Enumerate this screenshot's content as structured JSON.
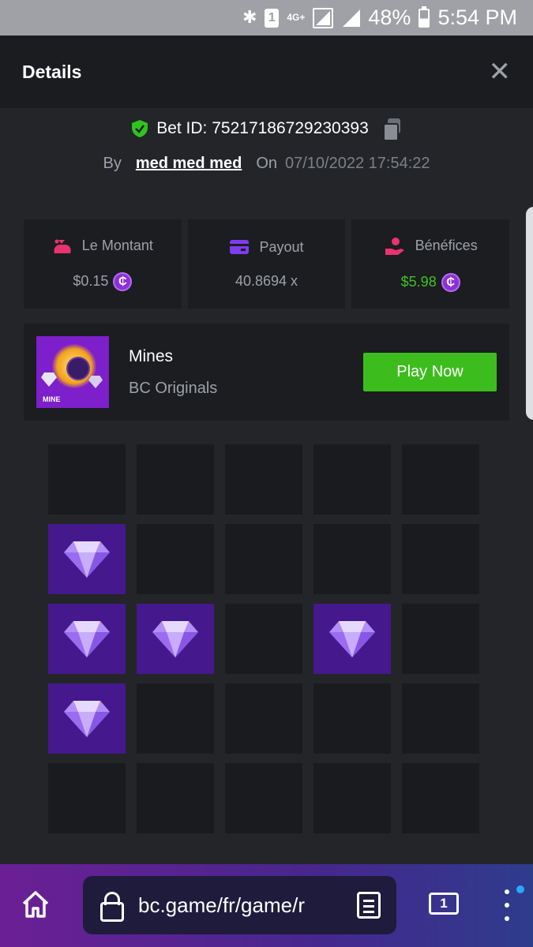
{
  "status_bar": {
    "network": "4G+",
    "sim": "1",
    "battery": "48%",
    "time": "5:54 PM"
  },
  "header": {
    "title": "Details"
  },
  "bet": {
    "id_label": "Bet ID: 75217186729230393",
    "by_label": "By",
    "user": "med med med",
    "on_label": "On",
    "date": "07/10/2022 17:54:22"
  },
  "stats": [
    {
      "label": "Le Montant",
      "value": "$0.15",
      "icon": "money-bag-icon",
      "color": "#e8336f"
    },
    {
      "label": "Payout",
      "value": "40.8694 x",
      "icon": "card-icon",
      "color": "#7d3cf0"
    },
    {
      "label": "Bénéfices",
      "value": "$5.98",
      "icon": "hand-coin-icon",
      "color": "#e8336f"
    }
  ],
  "coin_symbol": "₵",
  "game": {
    "name": "Mines",
    "provider": "BC Originals",
    "thumb_label": "MINE",
    "play_label": "Play Now"
  },
  "grid": {
    "rows": 5,
    "cols": 5,
    "tiles": [
      0,
      0,
      0,
      0,
      0,
      1,
      0,
      0,
      0,
      0,
      1,
      1,
      0,
      1,
      0,
      1,
      0,
      0,
      0,
      0,
      0,
      0,
      0,
      0,
      0
    ]
  },
  "browser": {
    "url": "bc.game/fr/game/r",
    "tab_count": "1"
  },
  "colors": {
    "accent_green": "#3dbd1d",
    "profit_green": "#3ec321",
    "gem_tile": "#45188d",
    "coin_purple": "#8b2fd6"
  }
}
